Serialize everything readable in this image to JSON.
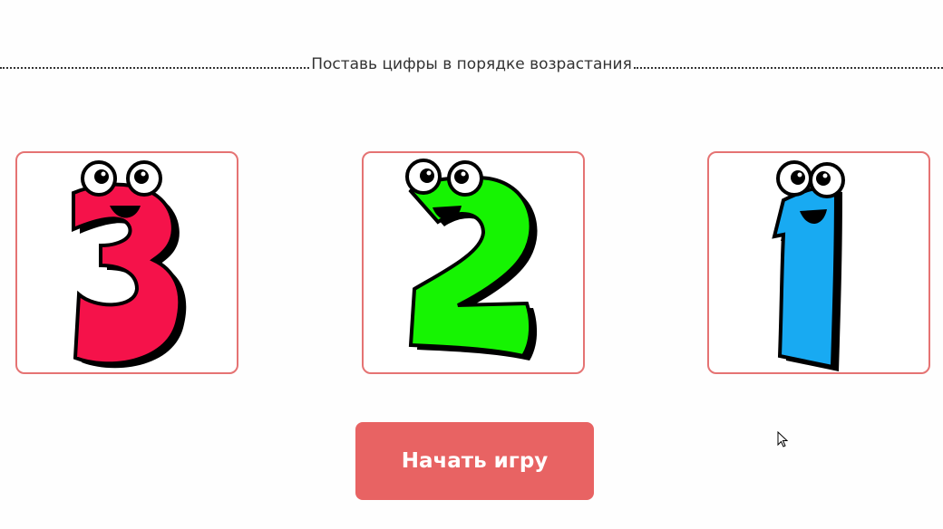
{
  "instruction": "Поставь цифры в порядке возрастания",
  "cards": [
    {
      "digit": "3",
      "color": "#f5124a",
      "icon": "cartoon-digit-three-icon"
    },
    {
      "digit": "2",
      "color": "#16f402",
      "icon": "cartoon-digit-two-icon"
    },
    {
      "digit": "1",
      "color": "#18aaf2",
      "icon": "cartoon-digit-one-icon"
    }
  ],
  "start_button": {
    "label": "Начать игру",
    "color": "#e86363"
  },
  "colors": {
    "card_border": "#e57373",
    "text": "#333333"
  }
}
